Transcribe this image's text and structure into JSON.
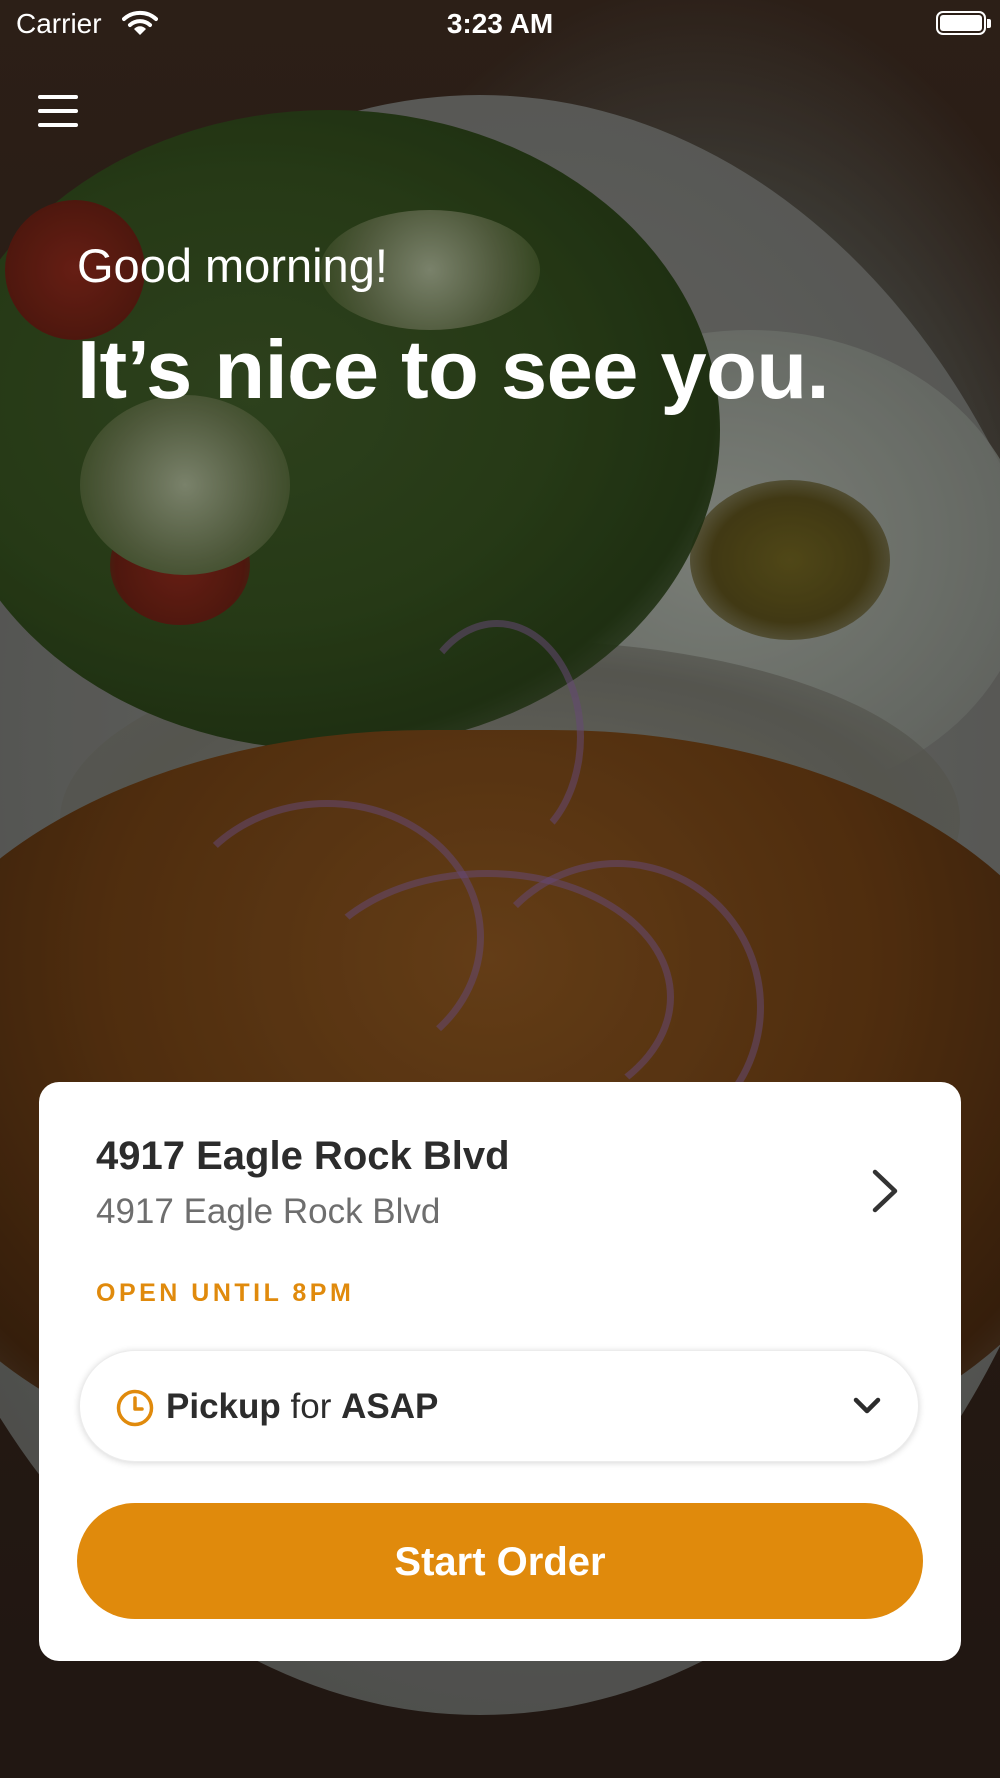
{
  "status_bar": {
    "carrier": "Carrier",
    "time": "3:23 AM"
  },
  "header": {
    "menu_icon": "hamburger-menu-icon"
  },
  "hero": {
    "greeting": "Good morning!",
    "headline": "It’s nice to see you."
  },
  "location_card": {
    "name": "4917 Eagle Rock Blvd",
    "address": "4917 Eagle Rock Blvd",
    "status": "OPEN UNTIL 8PM",
    "order_option": {
      "mode": "Pickup",
      "connector": "for",
      "time": "ASAP",
      "icon": "clock-icon"
    },
    "start_order_label": "Start Order"
  },
  "colors": {
    "accent": "#e08a0c",
    "card_background": "#ffffff",
    "text_primary": "#2c2c2c",
    "text_secondary": "#6e6e6e"
  }
}
